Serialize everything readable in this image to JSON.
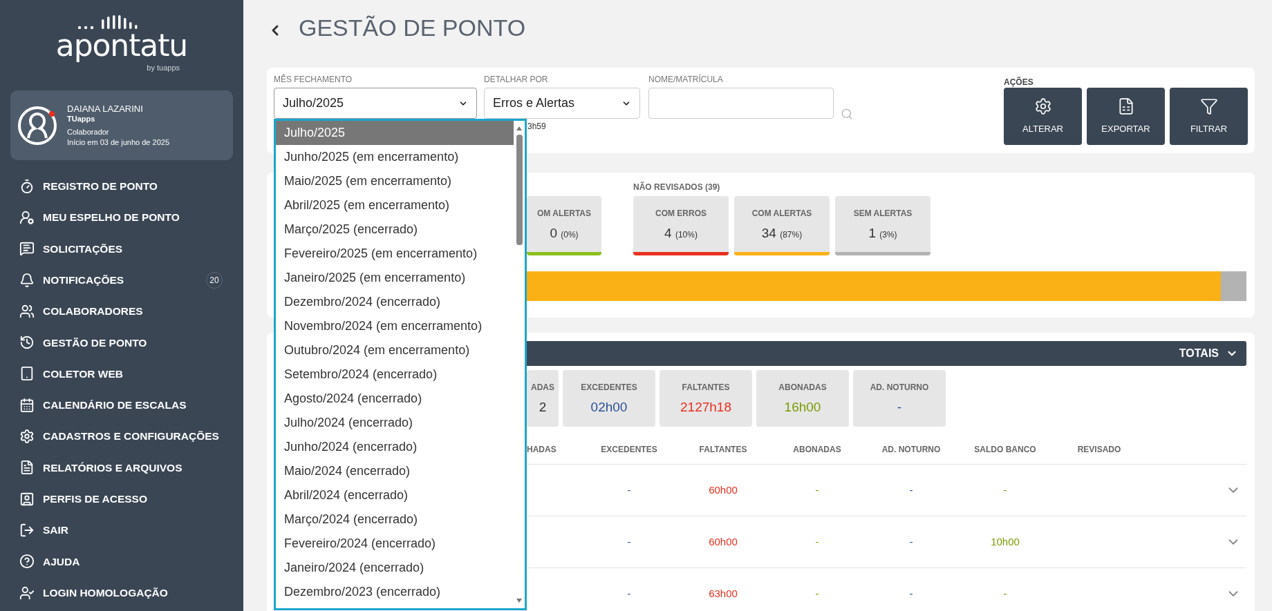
{
  "sidebar": {
    "logo": {
      "name": "apontatu",
      "by": "by tuapps"
    },
    "profile": {
      "name": "DAIANA LAZARINI",
      "company": "TUapps",
      "role": "Colaborador",
      "since": "Início em 03 de junho de 2025",
      "online": true
    },
    "items": [
      {
        "label": "REGISTRO DE PONTO"
      },
      {
        "label": "MEU ESPELHO DE PONTO"
      },
      {
        "label": "SOLICITAÇÕES"
      },
      {
        "label": "NOTIFICAÇÕES",
        "badge": "20"
      },
      {
        "label": "COLABORADORES"
      },
      {
        "label": "GESTÃO DE PONTO"
      },
      {
        "label": "COLETOR WEB"
      },
      {
        "label": "CALENDÁRIO DE ESCALAS"
      },
      {
        "label": "CADASTROS E CONFIGURAÇÕES"
      },
      {
        "label": "RELATÓRIOS E ARQUIVOS"
      },
      {
        "label": "PERFIS DE ACESSO"
      },
      {
        "label": "SAIR"
      },
      {
        "label": "AJUDA"
      },
      {
        "label": "LOGIN HOMOLOGAÇÃO"
      }
    ]
  },
  "page_title": "GESTÃO DE PONTO",
  "filters": {
    "month": {
      "label": "MÊS FECHAMENTO",
      "value": "Julho/2025",
      "expanded": true,
      "options": [
        {
          "label": "Julho/2025",
          "selected": true
        },
        {
          "label": "Junho/2025 (em encerramento)",
          "selected": false
        },
        {
          "label": "Maio/2025 (em encerramento)",
          "selected": false
        },
        {
          "label": "Abril/2025 (em encerramento)",
          "selected": false
        },
        {
          "label": "Março/2025 (encerrado)",
          "selected": false
        },
        {
          "label": "Fevereiro/2025 (em encerramento)",
          "selected": false
        },
        {
          "label": "Janeiro/2025 (em encerramento)",
          "selected": false
        },
        {
          "label": "Dezembro/2024 (encerrado)",
          "selected": false
        },
        {
          "label": "Novembro/2024 (em encerramento)",
          "selected": false
        },
        {
          "label": "Outubro/2024 (em encerramento)",
          "selected": false
        },
        {
          "label": "Setembro/2024 (encerrado)",
          "selected": false
        },
        {
          "label": "Agosto/2024 (encerrado)",
          "selected": false
        },
        {
          "label": "Julho/2024 (encerrado)",
          "selected": false
        },
        {
          "label": "Junho/2024 (encerrado)",
          "selected": false
        },
        {
          "label": "Maio/2024 (encerrado)",
          "selected": false
        },
        {
          "label": "Abril/2024 (encerrado)",
          "selected": false
        },
        {
          "label": "Março/2024 (encerrado)",
          "selected": false
        },
        {
          "label": "Fevereiro/2024 (encerrado)",
          "selected": false
        },
        {
          "label": "Janeiro/2024 (encerrado)",
          "selected": false
        },
        {
          "label": "Dezembro/2023 (encerrado)",
          "selected": false
        }
      ]
    },
    "detail": {
      "label": "DETALHAR POR",
      "value": "Erros e Alertas",
      "note": "3h59"
    },
    "search": {
      "label": "NOME/MATRÍCULA"
    },
    "actions": {
      "label": "AÇÕES",
      "buttons": [
        "ALTERAR",
        "EXPORTAR",
        "FILTRAR"
      ]
    }
  },
  "summary": {
    "partial_card": {
      "label": "OM ALERTAS",
      "value": "0",
      "percent": "(0%)",
      "color": "#8cc01d"
    },
    "group": {
      "label": "NÃO REVISADOS (39)",
      "cards": [
        {
          "label": "COM ERROS",
          "value": "4",
          "percent": "(10%)",
          "color": "#e8301f"
        },
        {
          "label": "COM ALERTAS",
          "value": "34",
          "percent": "(87%)",
          "color": "#f9b116"
        },
        {
          "label": "SEM ALERTAS",
          "value": "1",
          "percent": "(3%)",
          "color": "#b3b3b3"
        }
      ]
    },
    "bar": [
      {
        "level": 0.964,
        "color": "#f9b116"
      },
      {
        "level": 0.036,
        "color": "#b3b3b3"
      }
    ]
  },
  "totals": {
    "title": "TOTAIS",
    "expanded": false,
    "cards": [
      {
        "label": "ADAS",
        "value": "2",
        "color": "#333333"
      },
      {
        "label": "EXCEDENTES",
        "value": "02h00",
        "color": "#2b4f95"
      },
      {
        "label": "FALTANTES",
        "value": "2127h18",
        "color": "#e8301f"
      },
      {
        "label": "ABONADAS",
        "value": "16h00",
        "color": "#7a9b00"
      },
      {
        "label": "AD. NOTURNO",
        "value": "-",
        "color": "#2b4f95"
      }
    ],
    "columns": [
      "HADAS",
      "EXCEDENTES",
      "FALTANTES",
      "ABONADAS",
      "AD. NOTURNO",
      "SALDO BANCO",
      "REVISADO"
    ],
    "rows": [
      {
        "cells": [
          "",
          "-",
          "60h00",
          "-",
          "-",
          "-",
          ""
        ]
      },
      {
        "cells": [
          "",
          "-",
          "60h00",
          "-",
          "-",
          "10h00",
          ""
        ]
      },
      {
        "cells": [
          "",
          "-",
          "63h00",
          "-",
          "-",
          "-",
          ""
        ]
      }
    ]
  }
}
